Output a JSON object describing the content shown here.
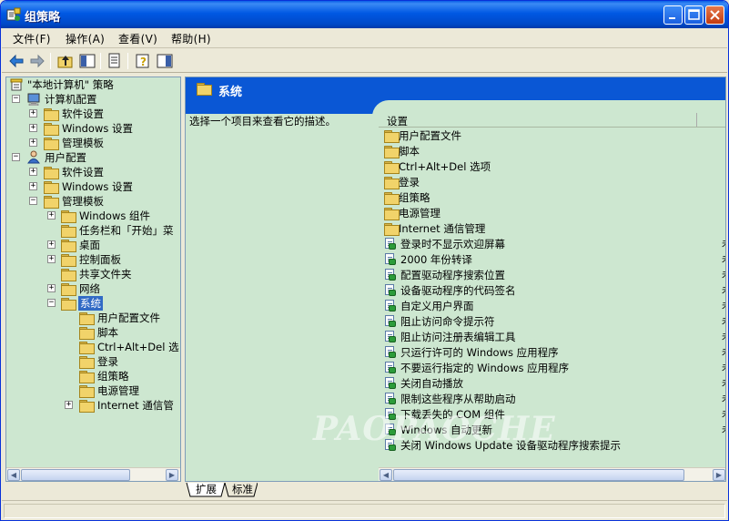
{
  "window": {
    "title": "组策略"
  },
  "menus": [
    "文件(F)",
    "操作(A)",
    "查看(V)",
    "帮助(H)"
  ],
  "tree": {
    "root": "\"本地计算机\" 策略",
    "computer_config": "计算机配置",
    "cc_software": "软件设置",
    "cc_windows": "Windows 设置",
    "cc_admin": "管理模板",
    "user_config": "用户配置",
    "uc_software": "软件设置",
    "uc_windows": "Windows 设置",
    "uc_admin": "管理模板",
    "admin_children": [
      "Windows 组件",
      "任务栏和「开始」菜",
      "桌面",
      "控制面板",
      "共享文件夹",
      "网络",
      "系统"
    ],
    "system_children": [
      "用户配置文件",
      "脚本",
      "Ctrl+Alt+Del 选",
      "登录",
      "组策略",
      "电源管理",
      "Internet 通信管"
    ]
  },
  "right": {
    "header": "系统",
    "description": "选择一个项目来查看它的描述。",
    "column_setting": "设置",
    "folders": [
      "用户配置文件",
      "脚本",
      "Ctrl+Alt+Del 选项",
      "登录",
      "组策略",
      "电源管理",
      "Internet 通信管理"
    ],
    "policies": [
      "登录时不显示欢迎屏幕",
      "2000 年份转译",
      "配置驱动程序搜索位置",
      "设备驱动程序的代码签名",
      "自定义用户界面",
      "阻止访问命令提示符",
      "阻止访问注册表编辑工具",
      "只运行许可的 Windows 应用程序",
      "不要运行指定的 Windows 应用程序",
      "关闭自动播放",
      "限制这些程序从帮助启动",
      "下载丢失的 COM 组件",
      "Windows 自动更新",
      "关闭 Windows Update 设备驱动程序搜索提示"
    ],
    "clipped_state": "未"
  },
  "tabs": [
    "扩展",
    "标准"
  ],
  "watermark": "PAOPAOCHE"
}
